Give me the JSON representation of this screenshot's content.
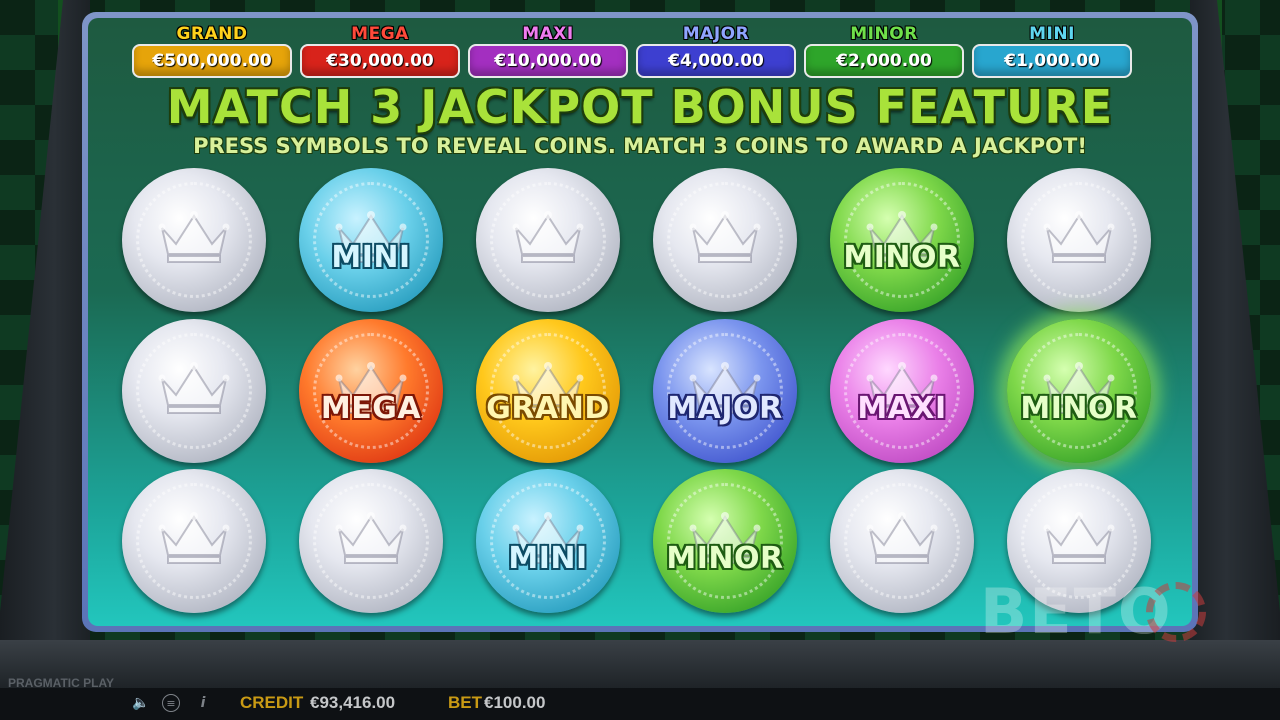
{
  "jackpots": [
    {
      "name": "GRAND",
      "amount": "€500,000.00",
      "title_color": "#ffd21c",
      "box_color": "#e6a40a"
    },
    {
      "name": "MEGA",
      "amount": "€30,000.00",
      "title_color": "#ff4a3a",
      "box_color": "#d8231b"
    },
    {
      "name": "MAXI",
      "amount": "€10,000.00",
      "title_color": "#f07cf0",
      "box_color": "#a32fc0"
    },
    {
      "name": "MAJOR",
      "amount": "€4,000.00",
      "title_color": "#8fa4ff",
      "box_color": "#3d3fd0"
    },
    {
      "name": "MINOR",
      "amount": "€2,000.00",
      "title_color": "#6fe04a",
      "box_color": "#2ea52a"
    },
    {
      "name": "MINI",
      "amount": "€1,000.00",
      "title_color": "#5fd6f0",
      "box_color": "#28a6cf"
    }
  ],
  "feature": {
    "title": "MATCH 3 JACKPOT BONUS FEATURE",
    "subtitle": "PRESS SYMBOLS TO REVEAL COINS. MATCH 3 COINS TO AWARD A JACKPOT!"
  },
  "coins": [
    [
      {
        "type": "silver",
        "label": ""
      },
      {
        "type": "mini",
        "label": "MINI"
      },
      {
        "type": "silver",
        "label": ""
      },
      {
        "type": "silver",
        "label": ""
      },
      {
        "type": "minor",
        "label": "MINOR"
      },
      {
        "type": "silver",
        "label": ""
      }
    ],
    [
      {
        "type": "silver",
        "label": ""
      },
      {
        "type": "mega",
        "label": "MEGA"
      },
      {
        "type": "grand",
        "label": "GRAND"
      },
      {
        "type": "major",
        "label": "MAJOR"
      },
      {
        "type": "maxi",
        "label": "MAXI"
      },
      {
        "type": "minor",
        "label": "MINOR",
        "highlighted": true
      }
    ],
    [
      {
        "type": "silver",
        "label": ""
      },
      {
        "type": "silver",
        "label": ""
      },
      {
        "type": "mini",
        "label": "MINI"
      },
      {
        "type": "minor",
        "label": "MINOR"
      },
      {
        "type": "silver",
        "label": ""
      },
      {
        "type": "silver",
        "label": ""
      }
    ]
  ],
  "status_bar": {
    "brand": "PRAGMATIC PLAY",
    "credit_label": "CREDIT",
    "credit_value": "€93,416.00",
    "bet_label": "BET",
    "bet_value": "€100.00",
    "icons": [
      "speaker-icon",
      "menu-icon",
      "info-icon"
    ]
  },
  "watermark": "BETO"
}
